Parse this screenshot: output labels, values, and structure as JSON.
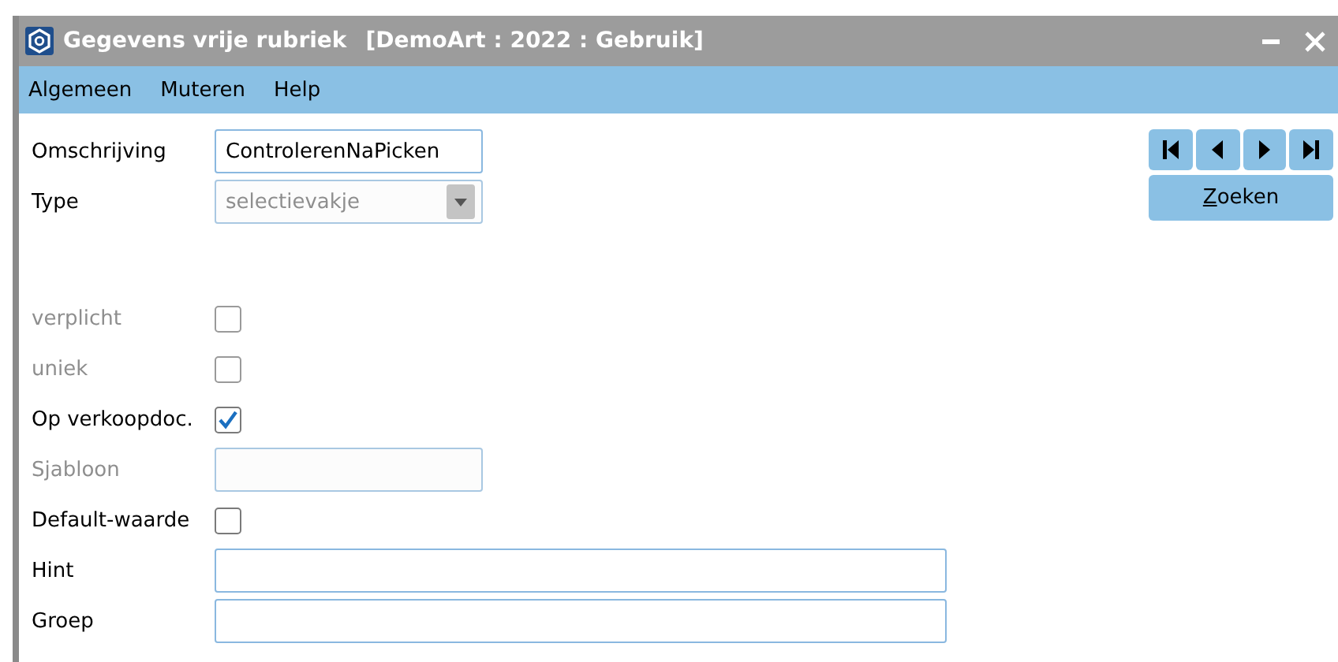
{
  "window": {
    "title": "Gegevens vrije rubriek",
    "context": "[DemoArt : 2022 : Gebruik]"
  },
  "menu": [
    "Algemeen",
    "Muteren",
    "Help"
  ],
  "fields": [
    {
      "label": "Omschrijving",
      "kind": "text",
      "disabled": false,
      "value": "ControlerenNaPicken",
      "wide": false
    },
    {
      "label": "Type",
      "kind": "select",
      "disabled": true,
      "label_dimmed": false,
      "value": "selectievakje"
    },
    {
      "kind": "spacer"
    },
    {
      "label": "verplicht",
      "kind": "checkbox",
      "disabled": true,
      "label_dimmed": true,
      "checked": false
    },
    {
      "label": "uniek",
      "kind": "checkbox",
      "disabled": true,
      "label_dimmed": true,
      "checked": false
    },
    {
      "label": "Op verkoopdoc.",
      "kind": "checkbox",
      "disabled": false,
      "checked": true
    },
    {
      "label": "Sjabloon",
      "kind": "text",
      "disabled": true,
      "label_dimmed": true,
      "wide": false
    },
    {
      "label": "Default-waarde",
      "kind": "checkbox",
      "disabled": false,
      "checked": false
    },
    {
      "label": "Hint",
      "kind": "text",
      "disabled": false,
      "wide": true
    },
    {
      "label": "Groep",
      "kind": "text",
      "disabled": false,
      "wide": true
    }
  ],
  "nav": [
    {
      "kind": "first"
    },
    {
      "kind": "previous"
    },
    {
      "kind": "next"
    },
    {
      "kind": "last"
    }
  ],
  "search_button": "Zoeken"
}
